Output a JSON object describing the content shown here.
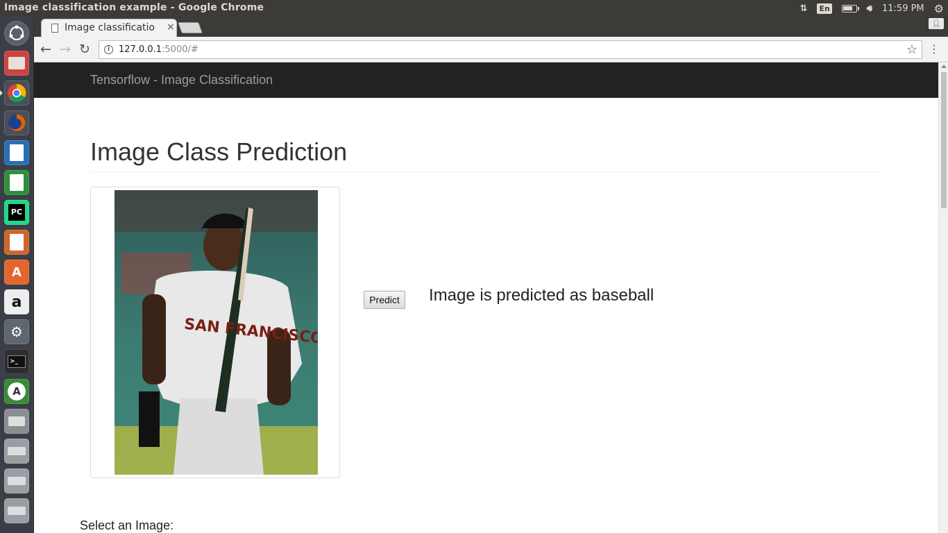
{
  "window_title": "Image classification example - Google Chrome",
  "system_tray": {
    "network_icon": "network-updown-icon",
    "language": "En",
    "battery_icon": "battery-icon",
    "volume_icon": "volume-icon",
    "clock": "11:59 PM",
    "settings_icon": "gear-icon"
  },
  "launcher": {
    "items": [
      {
        "name": "ubuntu-dash-icon"
      },
      {
        "name": "files-icon"
      },
      {
        "name": "chrome-icon"
      },
      {
        "name": "firefox-icon"
      },
      {
        "name": "writer-icon"
      },
      {
        "name": "calc-icon"
      },
      {
        "name": "pycharm-icon"
      },
      {
        "name": "impress-icon"
      },
      {
        "name": "software-center-icon"
      },
      {
        "name": "amazon-icon"
      },
      {
        "name": "system-settings-icon"
      },
      {
        "name": "terminal-icon"
      },
      {
        "name": "software-updater-icon"
      },
      {
        "name": "printer-icon"
      },
      {
        "name": "drive-icon"
      },
      {
        "name": "drive-icon"
      },
      {
        "name": "drive-icon"
      }
    ]
  },
  "browser": {
    "tab_title": "Image classificatio",
    "tab_close": "×",
    "url_host": "127.0.0.1",
    "url_path": ":5000/#"
  },
  "page": {
    "brand": "Tensorflow - Image Classification",
    "heading": "Image Class Prediction",
    "predict_label": "Predict",
    "prediction_text": "Image is predicted as baseball",
    "select_label": "Select an Image:"
  }
}
